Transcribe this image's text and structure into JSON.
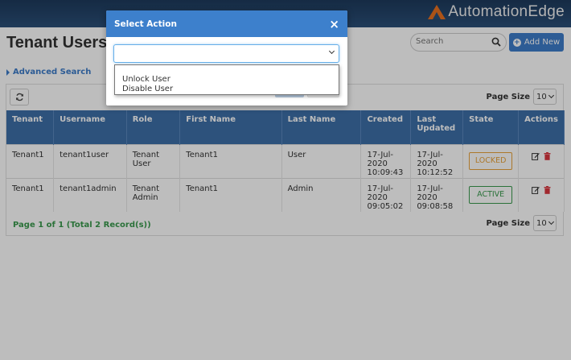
{
  "brand": {
    "name": "AutomationEdge",
    "accent": "#e9701f"
  },
  "page": {
    "title": "Tenant Users"
  },
  "search": {
    "placeholder": "Search"
  },
  "toolbar": {
    "add_label": "Add New"
  },
  "advanced_search": {
    "label": "Advanced Search"
  },
  "pagination": {
    "page_size_label": "Page Size",
    "page_size_value": "10",
    "records_text": "Page 1 of 1 (Total 2 Record(s))"
  },
  "table": {
    "columns": [
      "Tenant",
      "Username",
      "Role",
      "First Name",
      "Last Name",
      "Created",
      "Last Updated",
      "State",
      "Actions"
    ],
    "rows": [
      {
        "tenant": "Tenant1",
        "username": "tenant1user",
        "role": "Tenant User",
        "first_name": "Tenant1",
        "last_name": "User",
        "created": "17-Jul-2020 10:09:43",
        "last_updated": "17-Jul-2020 10:12:52",
        "state": "LOCKED"
      },
      {
        "tenant": "Tenant1",
        "username": "tenant1admin",
        "role": "Tenant Admin",
        "first_name": "Tenant1",
        "last_name": "Admin",
        "created": "17-Jul-2020 09:05:02",
        "last_updated": "17-Jul-2020 09:08:58",
        "state": "ACTIVE"
      }
    ]
  },
  "modal": {
    "title": "Select Action",
    "close_label": "×",
    "select_value": "",
    "options": [
      "Unlock User",
      "Disable User"
    ]
  },
  "colors": {
    "header_blue": "#3d6fa8",
    "modal_blue": "#3d80cc",
    "locked": "#e8a23a",
    "active": "#3a9a4e"
  },
  "icons": [
    "search-icon",
    "plus-circle-icon",
    "refresh-icon",
    "chevron-down-icon",
    "edit-icon",
    "trash-icon",
    "close-icon"
  ]
}
